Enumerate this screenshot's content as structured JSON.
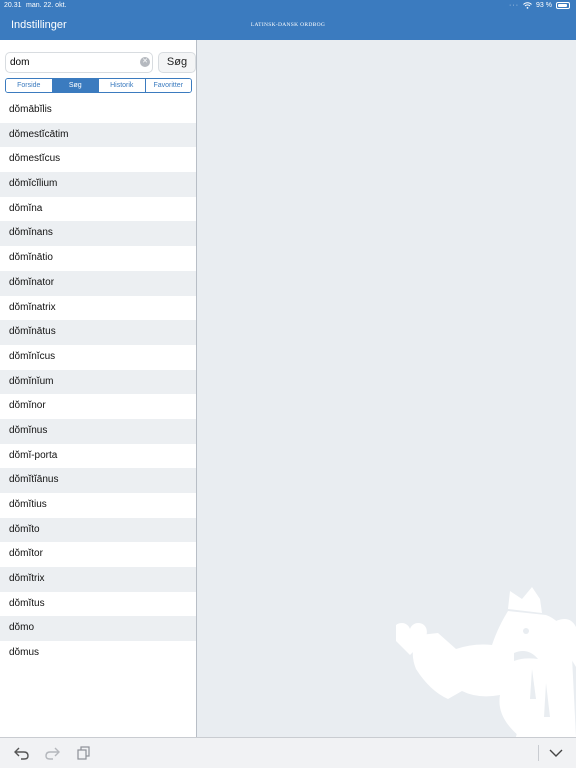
{
  "status_bar": {
    "time": "20.31",
    "date": "man. 22. okt.",
    "battery": "93 %",
    "battery_level": 0.93
  },
  "header": {
    "settings_label": "Indstillinger",
    "title": "LATINSK-DANSK ORDBOG"
  },
  "search": {
    "value": "dom",
    "button_label": "Søg"
  },
  "tabs": [
    {
      "label": "Forside",
      "active": false
    },
    {
      "label": "Søg",
      "active": true
    },
    {
      "label": "Historik",
      "active": false
    },
    {
      "label": "Favoritter",
      "active": false
    }
  ],
  "results": [
    "dŏmābĭlis",
    "dŏmestĭcātim",
    "dŏmestĭcus",
    "dŏmĭcĭlium",
    "dŏmĭna",
    "dŏmĭnans",
    "dŏmĭnātio",
    "dŏmĭnator",
    "dŏmĭnatrix",
    "dŏmĭnātus",
    "dŏmĭnĭcus",
    "dŏmĭnĭum",
    "dŏmĭnor",
    "dŏmĭnus",
    "dŏmĭ-porta",
    "dŏmĭtĭānus",
    "dŏmĭtius",
    "dŏmĭto",
    "dŏmĭtor",
    "dŏmĭtrix",
    "dŏmĭtus",
    "dŏmo",
    "dŏmus"
  ],
  "icons": {
    "wifi": "wifi-icon",
    "battery": "battery-icon",
    "clear": "clear-icon",
    "undo": "undo-icon",
    "redo": "redo-icon",
    "copy": "copy-icon",
    "collapse": "chevron-down-icon"
  },
  "colors": {
    "accent": "#3b7bbf",
    "background": "#e9edf1",
    "watermark": "#ffffff"
  }
}
